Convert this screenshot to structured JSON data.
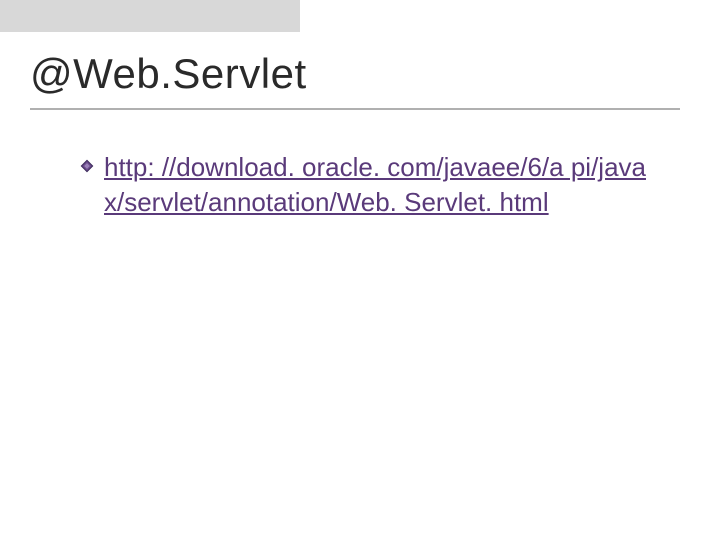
{
  "slide": {
    "title": "@Web.Servlet",
    "link": {
      "text": "http: //download. oracle. com/javaee/6/a pi/javax/servlet/annotation/Web. Servlet. html"
    }
  },
  "colors": {
    "bullet_border": "#5a3a7a",
    "bullet_fill": "#6a4a8a",
    "link_color": "#5a3a7a"
  }
}
